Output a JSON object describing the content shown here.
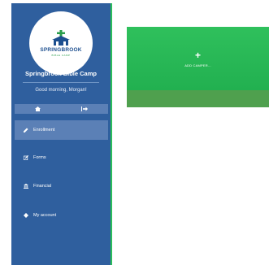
{
  "sidebar": {
    "logo": {
      "word": "SPRINGBROOK",
      "subtitle": "BIBLE CAMP"
    },
    "title": "Springbrook Bible Camp",
    "greeting": "Good morning, Morgan!",
    "icon_bar": [
      {
        "icon": "home-icon"
      },
      {
        "icon": "sign-out-icon"
      }
    ],
    "nav": [
      {
        "label": "Enrollment",
        "icon": "pencil-icon",
        "active": true
      },
      {
        "label": "Forms",
        "icon": "edit-icon",
        "active": false
      },
      {
        "label": "Financial",
        "icon": "bank-icon",
        "active": false
      },
      {
        "label": "My account",
        "icon": "gear-icon",
        "active": false
      }
    ]
  },
  "main": {
    "add_card": {
      "icon": "plus-icon",
      "label": "ADD CAMPER..."
    }
  },
  "colors": {
    "sidebar_bg": "#2f5f9e",
    "sidebar_active": "#5b80b6",
    "card_green": "#27b352",
    "card_footer": "#4fa04e"
  }
}
